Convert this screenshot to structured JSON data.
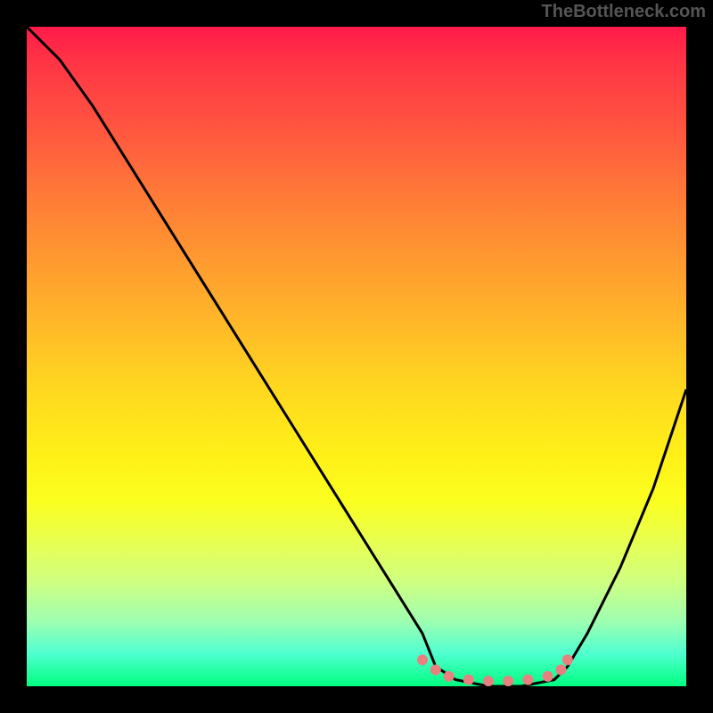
{
  "watermark": "TheBottleneck.com",
  "chart_data": {
    "type": "line",
    "title": "",
    "xlabel": "",
    "ylabel": "",
    "xlim": [
      0,
      100
    ],
    "ylim": [
      0,
      100
    ],
    "series": [
      {
        "name": "curve",
        "color": "#000000",
        "x": [
          0,
          5,
          10,
          15,
          20,
          25,
          30,
          35,
          40,
          45,
          50,
          55,
          60,
          62,
          65,
          70,
          75,
          80,
          82,
          85,
          90,
          95,
          100
        ],
        "y": [
          100,
          95,
          88,
          80,
          72,
          64,
          56,
          48,
          40,
          32,
          24,
          16,
          8,
          3,
          1,
          0,
          0,
          1,
          3,
          8,
          18,
          30,
          45
        ]
      },
      {
        "name": "dots",
        "color": "#e88080",
        "x": [
          60,
          62,
          64,
          67,
          70,
          73,
          76,
          79,
          81,
          82
        ],
        "y": [
          4,
          2.5,
          1.5,
          1,
          0.8,
          0.8,
          1,
          1.5,
          2.5,
          4
        ]
      }
    ],
    "gradient": {
      "top": "#ff1a4a",
      "mid1": "#ff9830",
      "mid2": "#fff018",
      "bottom": "#00ff80"
    }
  }
}
